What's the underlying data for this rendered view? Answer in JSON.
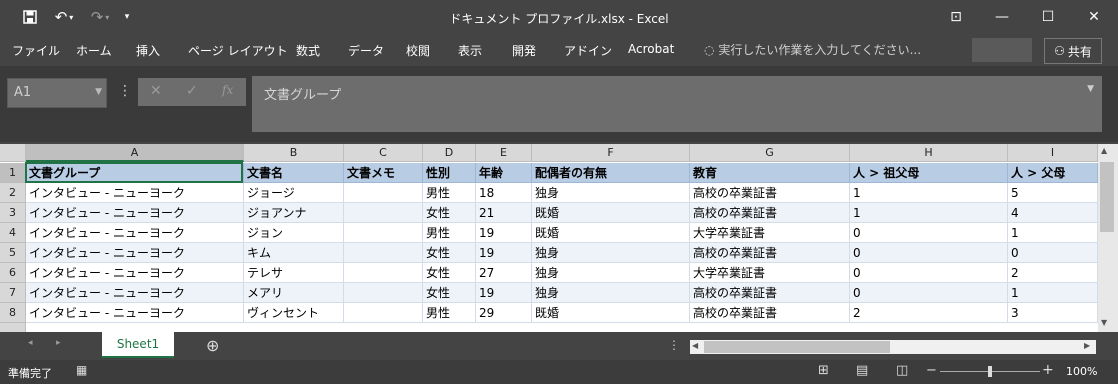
{
  "window": {
    "title": "ドキュメント プロファイル.xlsx - Excel",
    "save_icon": "save-icon",
    "undo_glyph": "↶",
    "redo_glyph": "↷",
    "customize_glyph": "▾",
    "controls": {
      "ribbon_display": "⊡",
      "minimize": "—",
      "restore": "☐",
      "close": "✕"
    }
  },
  "ribbon": {
    "tabs": [
      "ファイル",
      "ホーム",
      "挿入",
      "ページ レイアウト",
      "数式",
      "データ",
      "校閲",
      "表示",
      "開発",
      "アドイン",
      "Acrobat"
    ],
    "tell_me_placeholder": "実行したい作業を入力してください...",
    "share_label": "共有"
  },
  "formula_bar": {
    "name_box": "A1",
    "cancel_glyph": "✕",
    "enter_glyph": "✓",
    "fx_glyph": "fx",
    "value": "文書グループ"
  },
  "sheet": {
    "column_letters": [
      "A",
      "B",
      "C",
      "D",
      "E",
      "F",
      "G",
      "H",
      "I"
    ],
    "row_numbers": [
      "1",
      "2",
      "3",
      "4",
      "5",
      "6",
      "7",
      "8"
    ],
    "header_row": [
      "文書グループ",
      "文書名",
      "文書メモ",
      "性別",
      "年齢",
      "配偶者の有無",
      "教育",
      "人 > 祖父母",
      "人 > 父母"
    ],
    "rows": [
      [
        "インタビュー - ニューヨーク",
        "ジョージ",
        "",
        "男性",
        "18",
        "独身",
        "高校の卒業証書",
        "1",
        "5"
      ],
      [
        "インタビュー - ニューヨーク",
        "ジョアンナ",
        "",
        "女性",
        "21",
        "既婚",
        "高校の卒業証書",
        "1",
        "4"
      ],
      [
        "インタビュー - ニューヨーク",
        "ジョン",
        "",
        "男性",
        "19",
        "既婚",
        "大学卒業証書",
        "0",
        "1"
      ],
      [
        "インタビュー - ニューヨーク",
        "キム",
        "",
        "女性",
        "19",
        "独身",
        "高校の卒業証書",
        "0",
        "0"
      ],
      [
        "インタビュー - ニューヨーク",
        "テレサ",
        "",
        "女性",
        "27",
        "独身",
        "大学卒業証書",
        "0",
        "2"
      ],
      [
        "インタビュー - ニューヨーク",
        "メアリ",
        "",
        "女性",
        "19",
        "独身",
        "高校の卒業証書",
        "0",
        "1"
      ],
      [
        "インタビュー - ニューヨーク",
        "ヴィンセント",
        "",
        "男性",
        "29",
        "既婚",
        "高校の卒業証書",
        "2",
        "3"
      ]
    ]
  },
  "tabs_bar": {
    "sheet_name": "Sheet1",
    "add_glyph": "⊕"
  },
  "status": {
    "ready": "準備完了",
    "zoom": "100%",
    "zoom_minus": "−",
    "zoom_plus": "+"
  },
  "colors": {
    "excel_green": "#217346",
    "header_fill": "#b8cce4",
    "band_fill": "#eef3f9"
  }
}
